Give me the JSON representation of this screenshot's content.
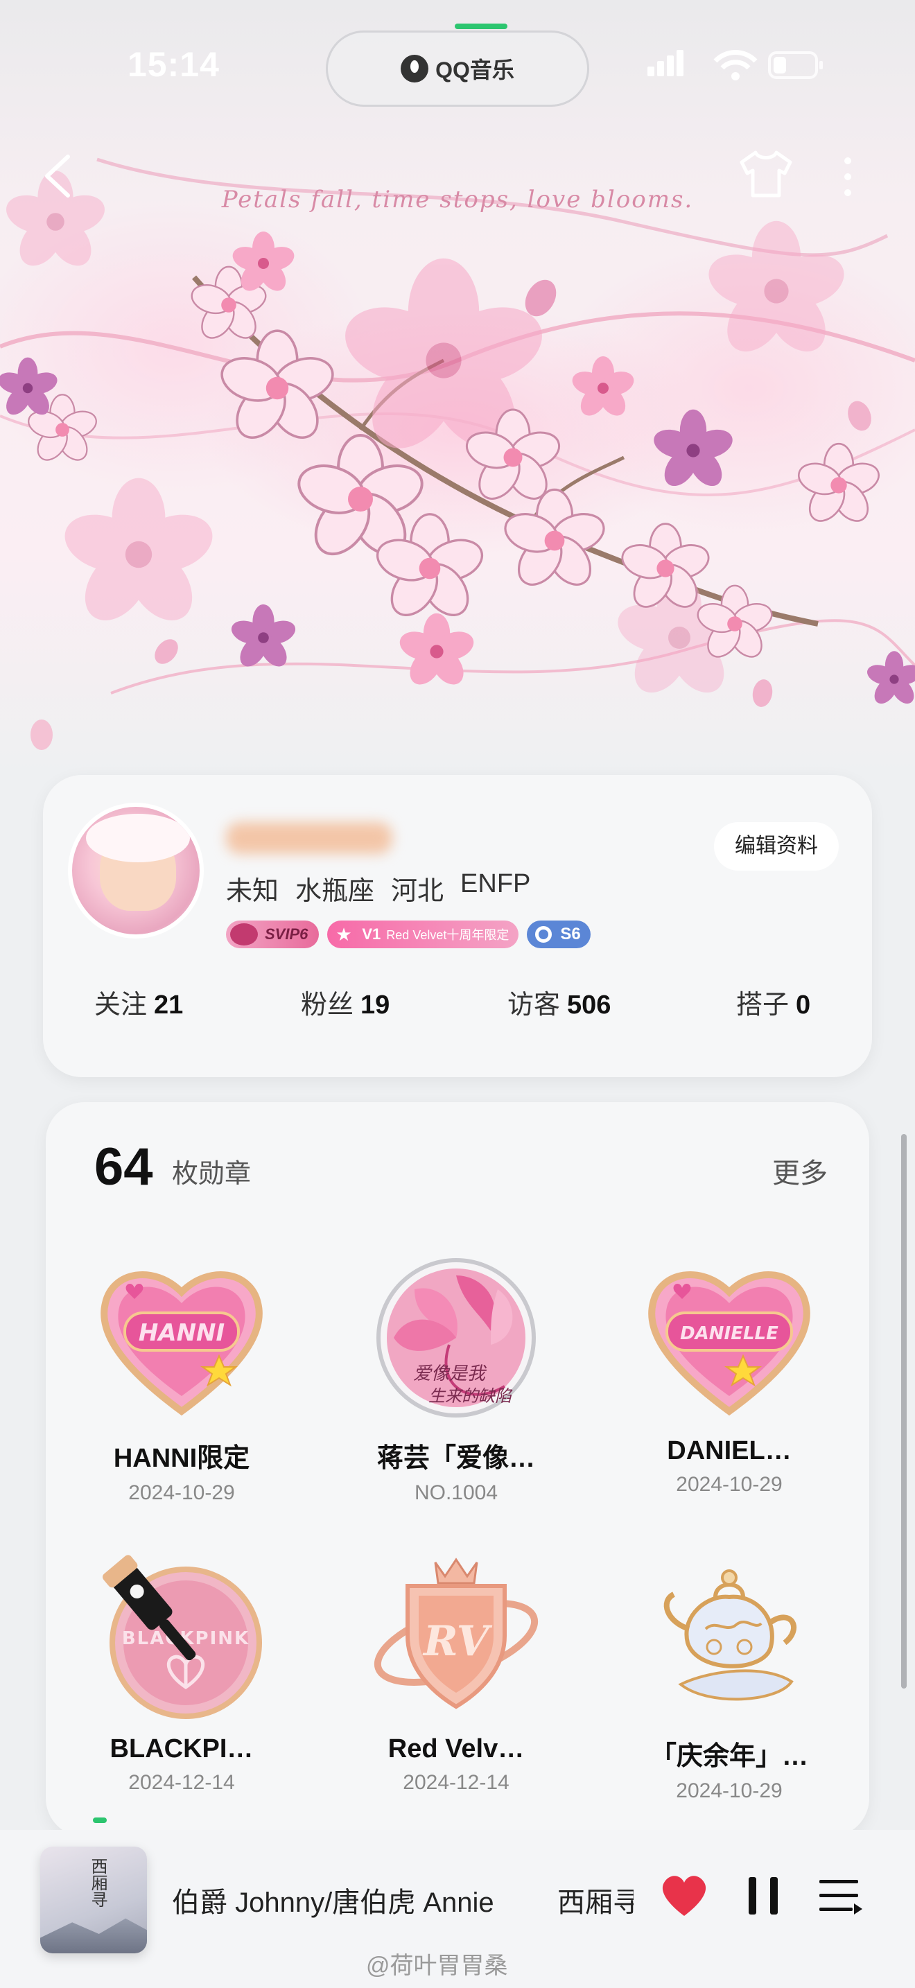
{
  "status_bar": {
    "time": "15:14",
    "app_island_label": "QQ音乐"
  },
  "header": {
    "slogan": "Petals fall, time stops, love blooms."
  },
  "profile": {
    "tags": [
      "未知",
      "水瓶座",
      "河北",
      "ENFP"
    ],
    "edit_button": "编辑资料",
    "badges": {
      "svip": "SVIP6",
      "v1_level": "V1",
      "v1_text": "Red Velvet十周年限定",
      "s_level": "S6"
    },
    "stats": [
      {
        "label": "关注",
        "value": "21"
      },
      {
        "label": "粉丝",
        "value": "19"
      },
      {
        "label": "访客",
        "value": "506"
      },
      {
        "label": "搭子",
        "value": "0"
      }
    ]
  },
  "medals": {
    "count": "64",
    "unit": "枚勋章",
    "more": "更多",
    "items": [
      {
        "name": "HANNI限定",
        "date": "2024-10-29",
        "icon": "hanni-heart-badge-icon"
      },
      {
        "name": "蒋芸「爱像…",
        "date": "NO.1004",
        "icon": "pink-flower-badge-icon"
      },
      {
        "name": "DANIEL…",
        "date": "2024-10-29",
        "icon": "danielle-heart-badge-icon"
      },
      {
        "name": "BLACKPI…",
        "date": "2024-12-14",
        "icon": "blackpink-badge-icon"
      },
      {
        "name": "Red Velv…",
        "date": "2024-12-14",
        "icon": "red-velvet-shield-badge-icon"
      },
      {
        "name": "「庆余年」…",
        "date": "2024-10-29",
        "icon": "teapot-badge-icon"
      }
    ]
  },
  "player": {
    "album_title": "西厢寻",
    "song_line": "伯爵 Johnny/唐伯虎 Annie",
    "song_line2": "西厢寻"
  },
  "watermark": "@荷叶胃胃桑",
  "colors": {
    "accent_green": "#2cc56f",
    "heart_red": "#e8334a",
    "card_bg": "#f6f7f8"
  }
}
